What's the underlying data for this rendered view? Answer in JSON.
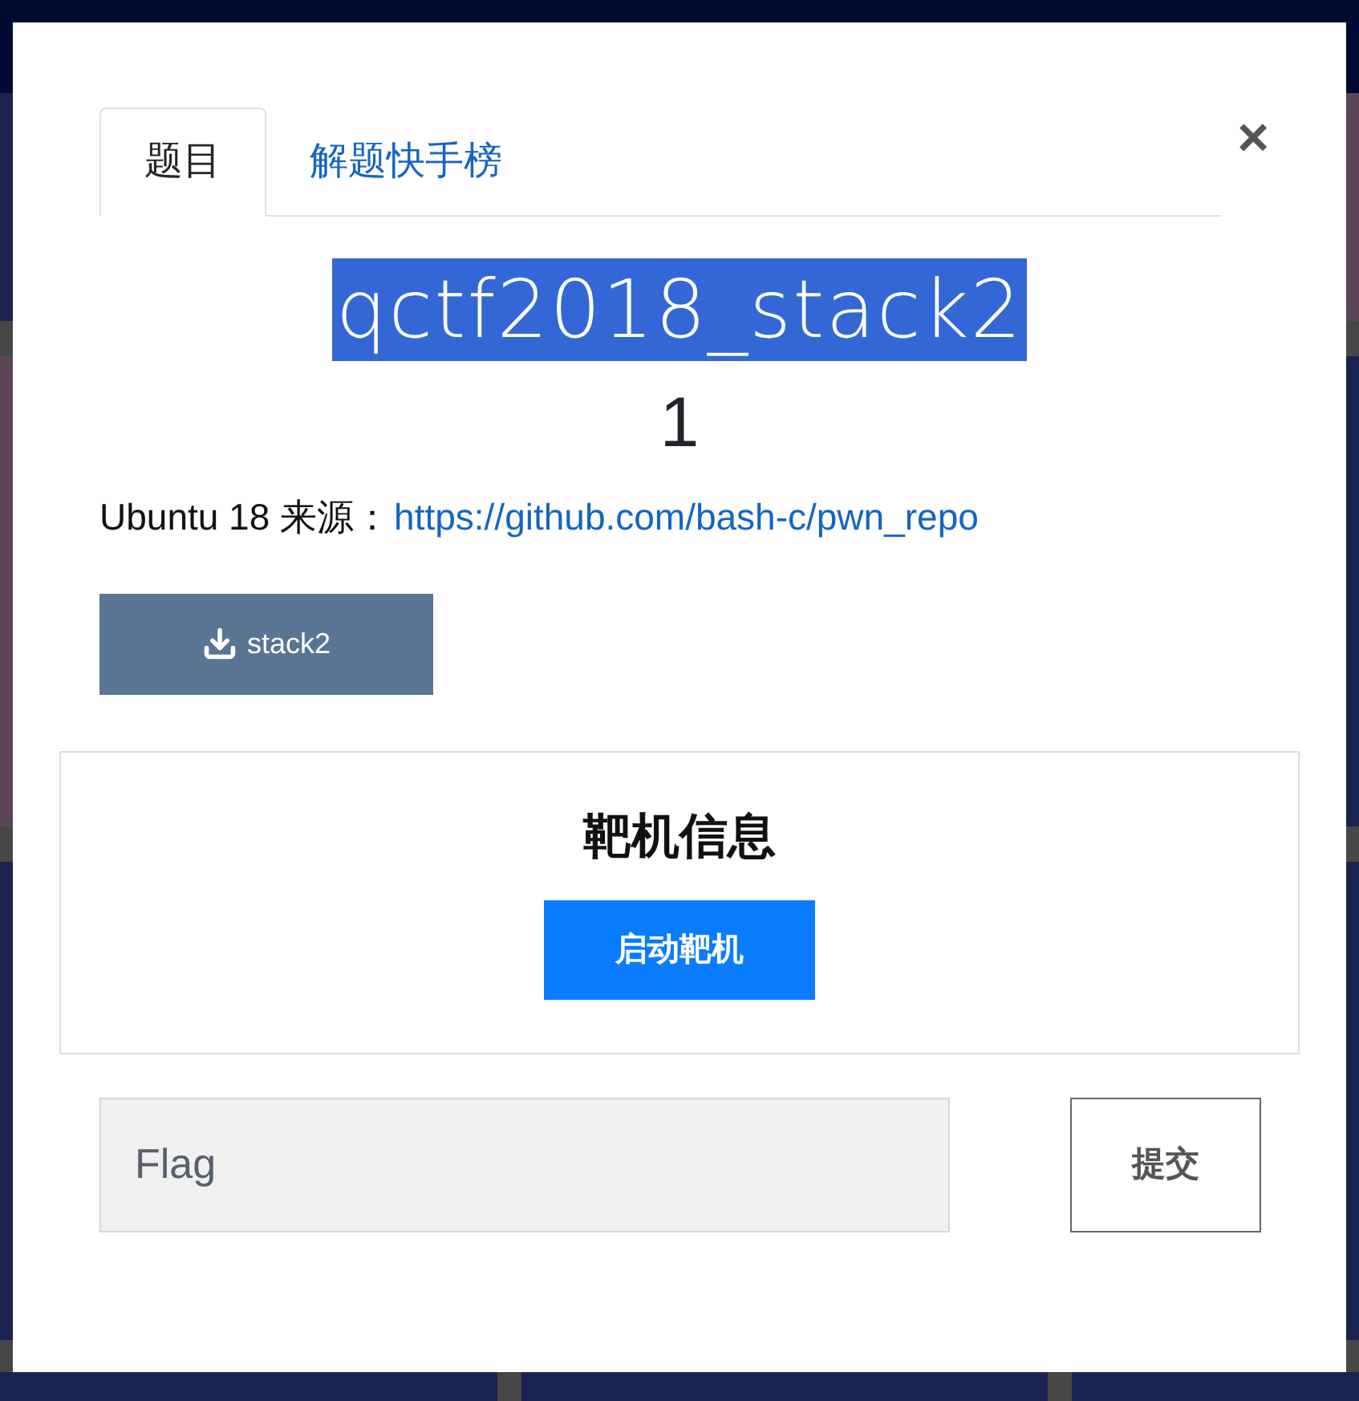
{
  "modal": {
    "tabs": [
      {
        "label": "题目",
        "selected": true
      },
      {
        "label": "解题快手榜",
        "selected": false
      }
    ],
    "close": "×",
    "title": "qctf2018_stack2",
    "title_highlighted": true,
    "score": "1",
    "description": "Ubuntu 18 来源：",
    "source_link": "https://github.com/bash-c/pwn_repo",
    "download": "stack2",
    "target": {
      "heading": "靶机信息",
      "button": "启动靶机"
    },
    "flag": {
      "placeholder": "Flag",
      "submit": "提交"
    }
  }
}
